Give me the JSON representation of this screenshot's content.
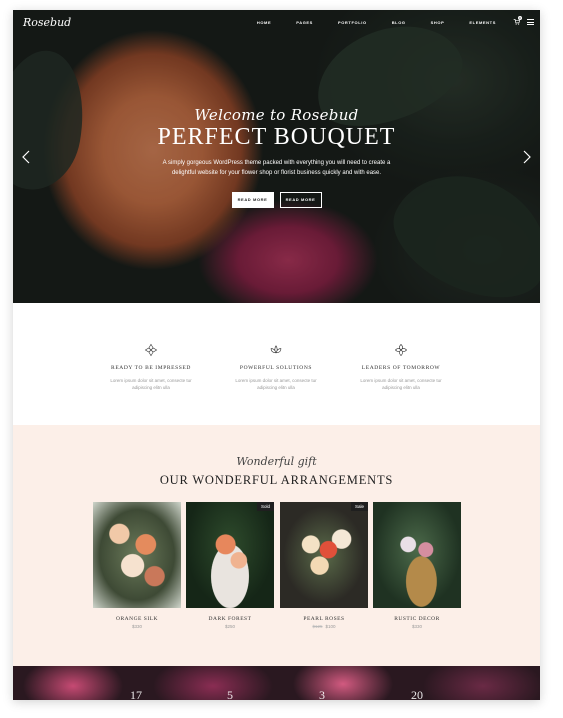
{
  "header": {
    "logo": "Rosebud",
    "nav": [
      "HOME",
      "PAGES",
      "PORTFOLIO",
      "BLOG",
      "SHOP",
      "ELEMENTS"
    ],
    "cart_count": "0"
  },
  "hero": {
    "script": "Welcome to Rosebud",
    "title": "PERFECT BOUQUET",
    "text": "A simply gorgeous WordPress theme packed with everything you will need to create a delightful website for your flower shop or florist business quickly and with ease.",
    "button_primary": "READ MORE",
    "button_secondary": "READ MORE"
  },
  "features": [
    {
      "title": "READY TO BE IMPRESSED",
      "text": "Lorem ipsum dolor sit amet, consecte tur adipiscing elitn ulla"
    },
    {
      "title": "POWERFUL SOLUTIONS",
      "text": "Lorem ipsum dolor sit amet, consecte tur adipiscing elitn ulla"
    },
    {
      "title": "LEADERS OF TOMORROW",
      "text": "Lorem ipsum dolor sit amet, consecte tur adipiscing elitn ulla"
    }
  ],
  "arrangements": {
    "script": "Wonderful gift",
    "title": "OUR WONDERFUL ARRANGEMENTS",
    "products": [
      {
        "name": "ORANGE SILK",
        "price": "$330",
        "old_price": "",
        "badge": ""
      },
      {
        "name": "DARK FOREST",
        "price": "$250",
        "old_price": "",
        "badge": "Sold"
      },
      {
        "name": "PEARL ROSES",
        "price": "$100",
        "old_price": "$125",
        "badge": "Sale"
      },
      {
        "name": "RUSTIC DECOR",
        "price": "$330",
        "old_price": "",
        "badge": ""
      }
    ]
  },
  "stats": [
    "17",
    "5",
    "3",
    "20"
  ],
  "colors": {
    "accent": "#222222",
    "section_bg": "#fcefe8"
  }
}
